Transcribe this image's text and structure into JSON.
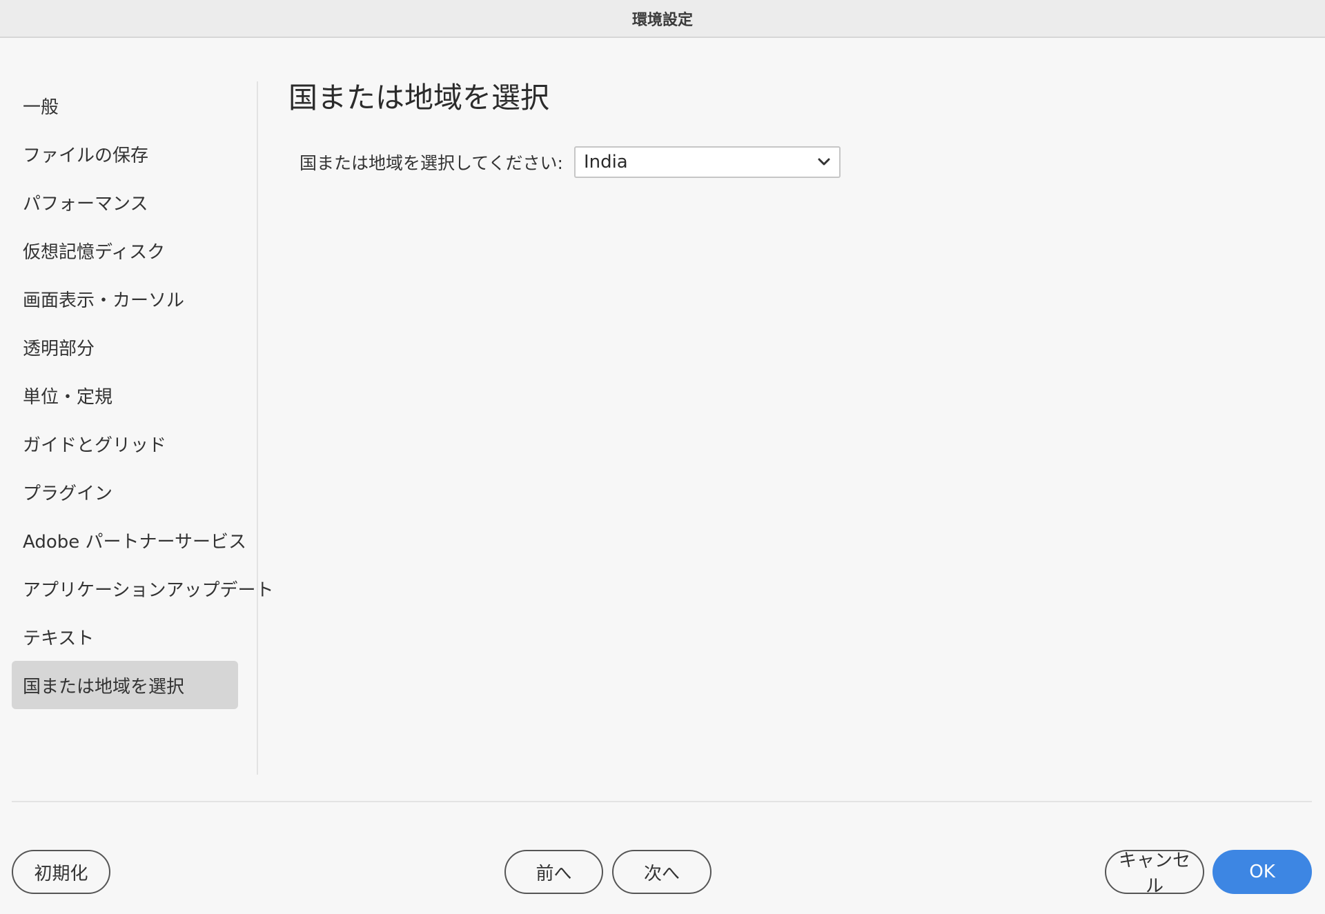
{
  "window": {
    "title": "環境設定"
  },
  "sidebar": {
    "items": [
      {
        "label": "一般"
      },
      {
        "label": "ファイルの保存"
      },
      {
        "label": "パフォーマンス"
      },
      {
        "label": "仮想記憶ディスク"
      },
      {
        "label": "画面表示・カーソル"
      },
      {
        "label": "透明部分"
      },
      {
        "label": "単位・定規"
      },
      {
        "label": "ガイドとグリッド"
      },
      {
        "label": "プラグイン"
      },
      {
        "label": "Adobe パートナーサービス"
      },
      {
        "label": "アプリケーションアップデート"
      },
      {
        "label": "テキスト"
      },
      {
        "label": "国または地域を選択"
      }
    ],
    "selected_index": 12
  },
  "main": {
    "title": "国または地域を選択",
    "field": {
      "label": "国または地域を選択してください:",
      "selected_value": "India",
      "icon": "chevron-down-icon"
    }
  },
  "buttons": {
    "reset": "初期化",
    "prev": "前へ",
    "next": "次へ",
    "cancel": "キャンセル",
    "ok": "OK"
  },
  "colors": {
    "accent": "#3d86e3",
    "selected_bg": "#d6d6d6",
    "background": "#f7f7f7"
  }
}
